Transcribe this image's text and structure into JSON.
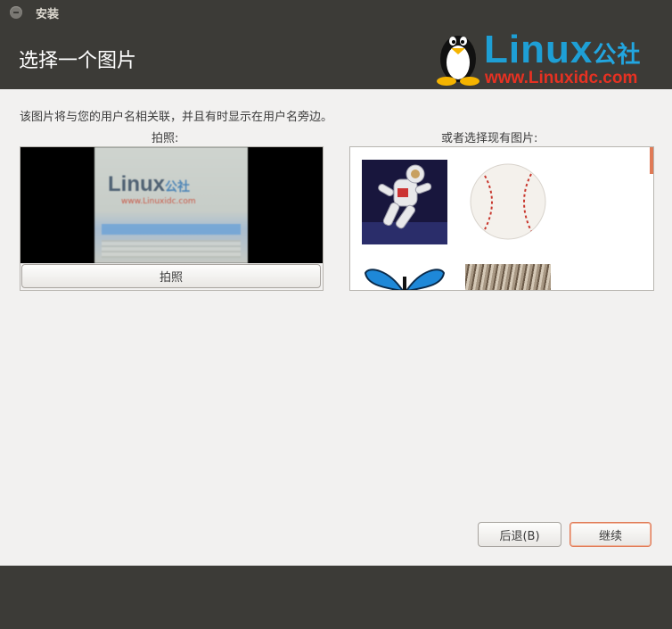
{
  "window": {
    "title": "安装"
  },
  "header": {
    "page_title": "选择一个图片"
  },
  "logo": {
    "wordmark": "Linux",
    "wordmark_suffix": "公社",
    "url": "www.Linuxidc.com"
  },
  "main": {
    "description": "该图片将与您的用户名相关联，并且有时显示在用户名旁边。",
    "camera": {
      "label": "拍照:",
      "button_label": "拍照",
      "preview_brand": "Linux",
      "preview_brand_suffix": "公社",
      "preview_url": "www.Linuxidc.com"
    },
    "gallery": {
      "label": "或者选择现有图片:",
      "images": [
        {
          "name": "astronaut"
        },
        {
          "name": "baseball"
        },
        {
          "name": "butterfly"
        },
        {
          "name": "fur"
        }
      ]
    }
  },
  "footer": {
    "back_label": "后退(B)",
    "continue_label": "继续"
  },
  "colors": {
    "dark_bg": "#3c3b37",
    "accent": "#e07a56",
    "dialog_bg": "#f2f1f0",
    "logo_blue": "#1e9fd5",
    "logo_red": "#e63122"
  }
}
